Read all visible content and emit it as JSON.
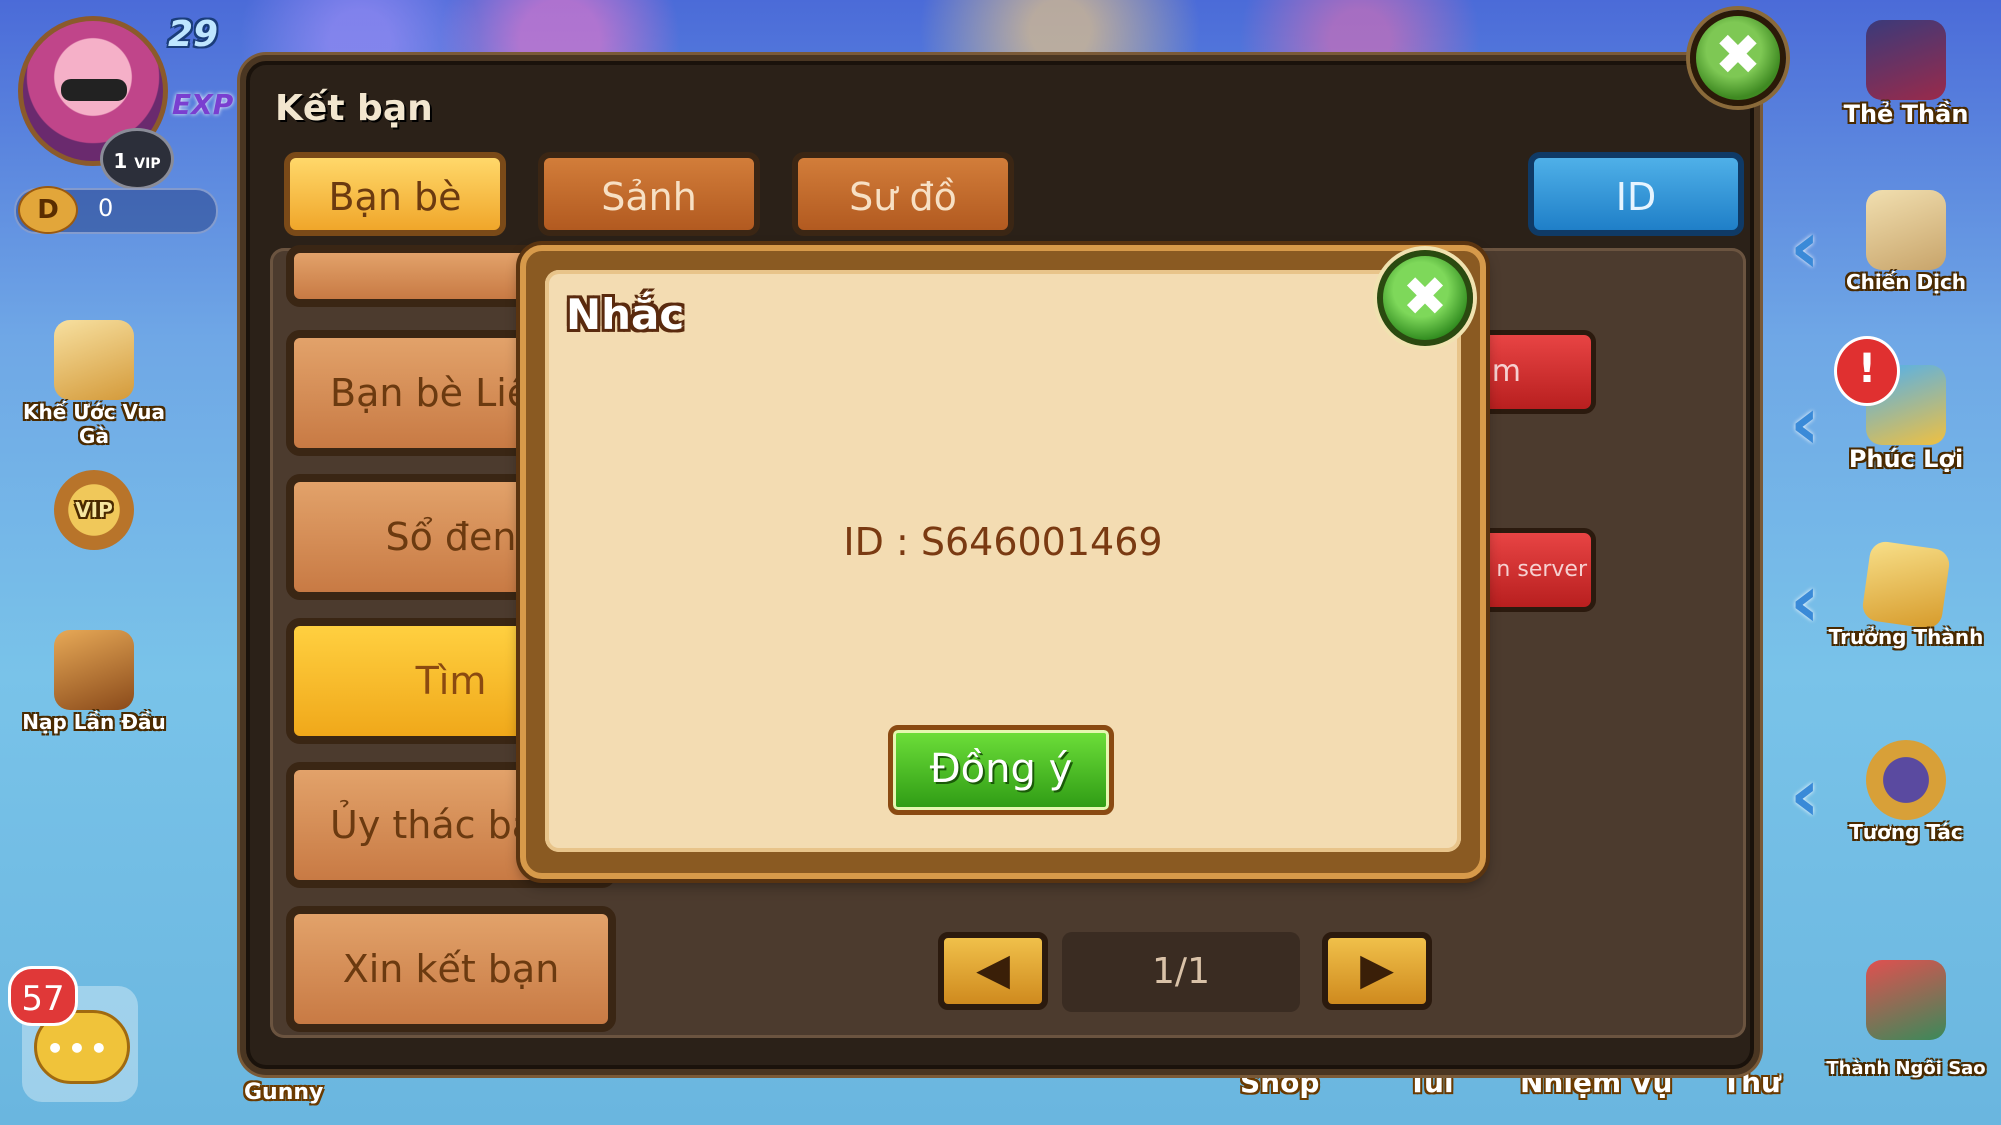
{
  "hud": {
    "level": "29",
    "exp_label": "EXP",
    "vip_level": "1",
    "vip_label": "VIP",
    "coin_icon": "D",
    "coin_value": "0",
    "message_count": "57"
  },
  "left_icons": [
    {
      "label": "Khế Ước Vua Gà",
      "icon": "scroll-icon"
    },
    {
      "label": "VIP",
      "icon": "vip-shield-icon"
    },
    {
      "label": "Nạp Lần Đầu",
      "icon": "treasure-chest-icon"
    }
  ],
  "right_icons": [
    {
      "label": "Thẻ Thần",
      "icon": "card-icon"
    },
    {
      "label": "Chiến Dịch",
      "icon": "map-scroll-icon"
    },
    {
      "label": "Phúc Lợi",
      "icon": "gift-box-icon"
    },
    {
      "label": "Trưởng Thành",
      "icon": "book-icon"
    },
    {
      "label": "Tương Tác",
      "icon": "shield-crest-icon"
    },
    {
      "label": "Thành Ngôi Sao",
      "icon": "star-ship-icon"
    }
  ],
  "bottom_bar": {
    "left_label": "Gunny",
    "items": [
      "Shop",
      "Túi",
      "Nhiệm Vụ",
      "Thư"
    ]
  },
  "friend_window": {
    "title": "Kết bạn",
    "close_glyph": "✖",
    "tabs": [
      {
        "label": "Bạn bè",
        "active": true
      },
      {
        "label": "Sảnh",
        "active": false
      },
      {
        "label": "Sư đồ",
        "active": false
      }
    ],
    "id_tab": "ID",
    "left_buttons": [
      {
        "label": "Bạn bè Liên",
        "active": false
      },
      {
        "label": "Sổ đen",
        "active": false
      },
      {
        "label": "Tìm",
        "active": true
      },
      {
        "label": "Ủy thác bạn",
        "active": false
      },
      {
        "label": "Xin kết bạn",
        "active": false
      }
    ],
    "right_buttons": [
      "m",
      "n server"
    ],
    "pager": {
      "prev": "◀",
      "page": "1/1",
      "next": "▶"
    }
  },
  "dialog": {
    "title": "Nhắc",
    "close_glyph": "✖",
    "message": "ID : S646001469",
    "ok_label": "Đồng ý"
  }
}
